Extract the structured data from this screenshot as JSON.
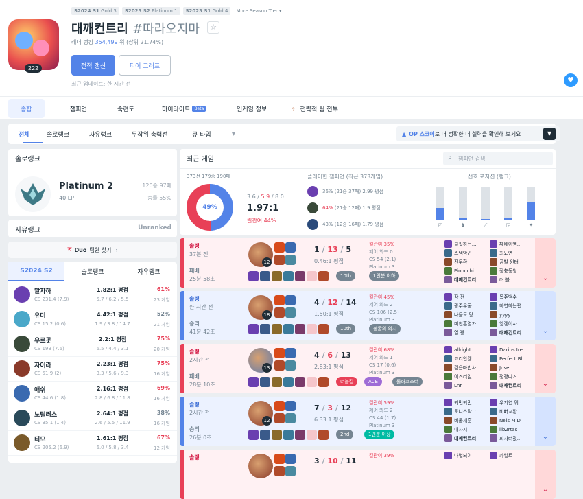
{
  "header": {
    "tiers": [
      {
        "season": "S2024 S1",
        "tier": "Gold 3"
      },
      {
        "season": "S2023 S2",
        "tier": "Platinum 1"
      },
      {
        "season": "S2023 S1",
        "tier": "Gold 4"
      }
    ],
    "more_tier": "More Season Tier ▾",
    "level": "222",
    "summoner_name": "대깨컨트리",
    "tagline": "#따라오지마",
    "ladder_prefix": "래더 랭킹",
    "ladder_rank": "354,499",
    "ladder_suffix": "위 (상위 21.74%)",
    "renew_label": "전적 갱신",
    "tier_graph_label": "티어 그래프",
    "last_updated": "최근 업데이트: 한 시간 전"
  },
  "nav": {
    "items": [
      "종합",
      "챔피언",
      "숙련도",
      "하이라이트",
      "인게임 정보",
      "전략적 팀 전투"
    ],
    "beta": "Beta"
  },
  "queue_tabs": {
    "items": [
      "전체",
      "솔로랭크",
      "자유랭크",
      "무작위 총력전",
      "큐 타입"
    ],
    "op_hint_prefix": "OP 스코어",
    "op_hint_suffix": "로 더 정확한 내 실력을 확인해 보세요"
  },
  "solo_rank": {
    "title": "솔로랭크",
    "tier": "Platinum 2",
    "lp": "40 LP",
    "wl": "120승 97패",
    "winrate": "승률 55%"
  },
  "flex_rank": {
    "title": "자유랭크",
    "status": "Unranked"
  },
  "duo": {
    "label": "Duo",
    "text": "팀원 찾기"
  },
  "champ_stats": {
    "tabs": [
      "S2024 S2",
      "솔로랭크",
      "자유랭크"
    ],
    "rows": [
      {
        "name": "말자하",
        "cs": "CS 231.4 (7.9)",
        "kda": "1.82:1 평점",
        "kda_detail": "5.7 / 6.2 / 5.5",
        "wr": "61%",
        "games": "23 게임",
        "wr_color": "#e84057",
        "color": "#6a3fb0"
      },
      {
        "name": "유미",
        "cs": "CS 15.2 (0.6)",
        "kda": "4.42:1 평점",
        "kda_detail": "1.9 / 3.8 / 14.7",
        "wr": "52%",
        "games": "21 게임",
        "wr_color": "#758592",
        "color": "#4aa8c9"
      },
      {
        "name": "우르곳",
        "cs": "CS 193 (7.6)",
        "kda": "2.2:1 평점",
        "kda_detail": "6.5 / 4.4 / 3.1",
        "wr": "75%",
        "games": "20 게임",
        "wr_color": "#e84057",
        "color": "#3a4a3a"
      },
      {
        "name": "자이라",
        "cs": "CS 51.9 (2)",
        "kda": "2.23:1 평점",
        "kda_detail": "3.3 / 5.6 / 9.3",
        "wr": "75%",
        "games": "16 게임",
        "wr_color": "#e84057",
        "color": "#8a3a2a"
      },
      {
        "name": "애쉬",
        "cs": "CS 44.6 (1.8)",
        "kda": "2.16:1 평점",
        "kda_detail": "2.8 / 6.8 / 11.8",
        "wr": "69%",
        "games": "16 게임",
        "wr_color": "#e84057",
        "color": "#3a6ab0"
      },
      {
        "name": "노틸러스",
        "cs": "CS 35.1 (1.4)",
        "kda": "2.64:1 평점",
        "kda_detail": "2.6 / 5.5 / 11.9",
        "wr": "38%",
        "games": "16 게임",
        "wr_color": "#758592",
        "color": "#2a4a5a"
      },
      {
        "name": "티모",
        "cs": "CS 205.2 (6.9)",
        "kda": "1.61:1 평점",
        "kda_detail": "6.0 / 5.8 / 3.4",
        "wr": "67%",
        "games": "12 게임",
        "wr_color": "#e84057",
        "color": "#7a5a2a"
      }
    ]
  },
  "recent": {
    "title": "최근 게임",
    "search_placeholder": "챔피언 검색",
    "summary": "373전 179승 190패",
    "winrate": "49%",
    "kda_k": "3.6",
    "kda_d": "5.9",
    "kda_a": "8.0",
    "sep": "/",
    "kda_ratio": "1.97:1",
    "kp": "킬관여 44%",
    "played_title": "플레이한 챔피언 (최근 373게임)",
    "played": [
      {
        "wr": "36%",
        "detail": "(21승 37패) 2.99 평점",
        "color": "#6a3fb0",
        "red": false
      },
      {
        "wr": "64%",
        "detail": "(21승 12패) 1.9 평점",
        "color": "#3a4a3a",
        "red": true
      },
      {
        "wr": "43%",
        "detail": "(12승 16패) 1.79 평점",
        "color": "#2a4a7a",
        "red": false
      }
    ],
    "pos_title": "선호 포지션 (랭크)",
    "positions": [
      {
        "icon": "◰",
        "fraction": 0.35
      },
      {
        "icon": "♞",
        "fraction": 0.05
      },
      {
        "icon": "⟋",
        "fraction": 0.03
      },
      {
        "icon": "◲",
        "fraction": 0.06
      },
      {
        "icon": "✦",
        "fraction": 0.52
      }
    ]
  },
  "games": [
    {
      "result_class": "loss",
      "type": "솔랭",
      "ago": "37분 전",
      "result": "패배",
      "duration": "25분 58초",
      "k": "1",
      "d": "13",
      "a": "5",
      "ratio": "0.46:1 평점",
      "level": "12",
      "champ_color": "#8a3a2a",
      "kp": "킬관여 35%",
      "wards": "제어 와드 0",
      "cs": "CS 54 (2.1)",
      "tier": "Platinum 3",
      "badges": [
        {
          "text": "10th",
          "color": "#758592"
        },
        {
          "text": "1인분 이하",
          "color": "#758592"
        }
      ],
      "players": [
        "쿨핏하는...",
        "스택악귀",
        "전두환",
        "Pinocchi...",
        "대깨컨트리",
        "째에이엠...",
        "최도연",
        "곰발 윈터",
        "장충동왕...",
        "러 블"
      ]
    },
    {
      "result_class": "win",
      "type": "솔랭",
      "ago": "한 시간 전",
      "result": "승리",
      "duration": "41분 42초",
      "k": "4",
      "d": "12",
      "a": "14",
      "ratio": "1.50:1 평점",
      "level": "18",
      "champ_color": "#8a3a2a",
      "kp": "킬관여 45%",
      "wards": "제어 와드 2",
      "cs": "CS 106 (2.5)",
      "tier": "Platinum 3",
      "badges": [
        {
          "text": "10th",
          "color": "#758592"
        },
        {
          "text": "불굴의 의지",
          "color": "#758592"
        }
      ],
      "players": [
        "작 전",
        "광주우동...",
        "나들도 당...",
        "미친흠영가",
        "열 꽝",
        "목주백수",
        "하연하는편",
        "yyyy",
        "앙갱어사",
        "대깨컨트리"
      ]
    },
    {
      "result_class": "loss",
      "type": "솔랭",
      "ago": "2시간 전",
      "result": "패배",
      "duration": "28분 10초",
      "k": "4",
      "d": "6",
      "a": "13",
      "ratio": "2.83:1 평점",
      "level": "13",
      "champ_color": "#5a7ab0",
      "kp": "킬관여 68%",
      "wards": "제어 와드 1",
      "cs": "CS 17 (0.6)",
      "tier": "Platinum 3",
      "badges": [
        {
          "text": "더블킬",
          "color": "#e84057"
        },
        {
          "text": "ACE",
          "color": "#9e6cd6"
        },
        {
          "text": "롤러코스터",
          "color": "#758592"
        }
      ],
      "players": [
        "allright",
        "코리안갱...",
        "검은마법사",
        "이즈리얼...",
        "Lnr",
        "Darius Ire...",
        "Perfect Bl...",
        "Juse",
        "정정따거...",
        "대깨컨트리"
      ]
    },
    {
      "result_class": "win",
      "type": "솔랭",
      "ago": "2시간 전",
      "result": "승리",
      "duration": "26분 0초",
      "k": "7",
      "d": "3",
      "a": "12",
      "ratio": "6.33:1 평점",
      "level": "12",
      "champ_color": "#8a3a2a",
      "kp": "킬관여 59%",
      "wards": "제어 와드 2",
      "cs": "CS 44 (1.7)",
      "tier": "Platinum 3",
      "badges": [
        {
          "text": "2nd",
          "color": "#758592"
        },
        {
          "text": "1인분 이상",
          "color": "#00bba3"
        }
      ],
      "players": [
        "커먼커먼",
        "토니스탁그",
        "비둘재훈",
        "내사시",
        "대깨컨트리",
        "우기연 뭐...",
        "비버교황...",
        "Neis MID",
        "lib2rtas",
        "회사터졌..."
      ]
    },
    {
      "result_class": "loss",
      "type": "솔랭",
      "ago": "",
      "result": "",
      "duration": "",
      "k": "3",
      "d": "10",
      "a": "11",
      "ratio": "",
      "level": "",
      "champ_color": "#8a3a2a",
      "kp": "킬관여 39%",
      "wards": "",
      "cs": "",
      "tier": "",
      "badges": [],
      "players": [
        "나법되이",
        "",
        "",
        "",
        "",
        "카일르",
        "",
        "",
        "",
        ""
      ]
    }
  ]
}
